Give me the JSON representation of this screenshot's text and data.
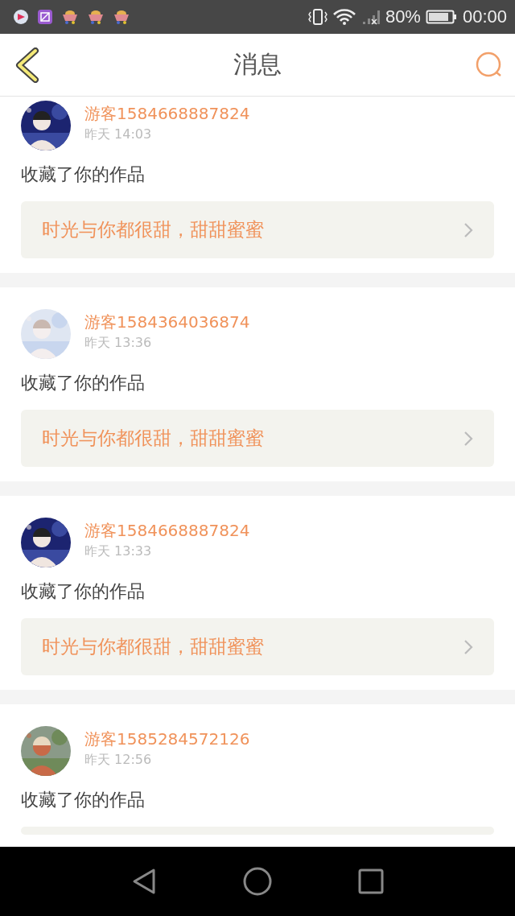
{
  "status_bar": {
    "battery": "80%",
    "time": "00:00"
  },
  "header": {
    "title": "消息"
  },
  "messages": [
    {
      "user": "游客1584668887824",
      "time": "昨天 14:03",
      "action": "收藏了你的作品",
      "work": "时光与你都很甜，甜甜蜜蜜"
    },
    {
      "user": "游客1584364036874",
      "time": "昨天 13:36",
      "action": "收藏了你的作品",
      "work": "时光与你都很甜，甜甜蜜蜜"
    },
    {
      "user": "游客1584668887824",
      "time": "昨天 13:33",
      "action": "收藏了你的作品",
      "work": "时光与你都很甜，甜甜蜜蜜"
    },
    {
      "user": "游客1585284572126",
      "time": "昨天 12:56",
      "action": "收藏了你的作品"
    }
  ]
}
